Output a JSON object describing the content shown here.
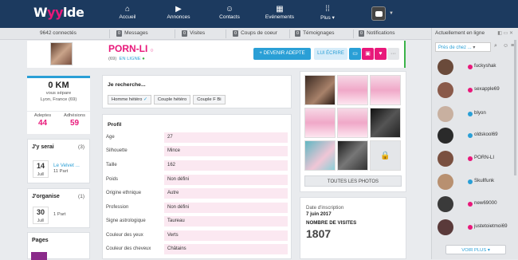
{
  "brand": {
    "logo_prefix": "W",
    "logo_yy": "yy",
    "logo_suffix": "lde"
  },
  "nav": [
    {
      "label": "Accueil",
      "icon": "home-icon"
    },
    {
      "label": "Annonces",
      "icon": "megaphone-icon"
    },
    {
      "label": "Contacts",
      "icon": "users-icon"
    },
    {
      "label": "Evénements",
      "icon": "calendar-icon"
    },
    {
      "label": "Plus",
      "icon": "grid-icon"
    }
  ],
  "stats": {
    "connected": "9642 connectés",
    "messages": {
      "count": "0",
      "label": "Messages"
    },
    "visites": {
      "count": "0",
      "label": "Visites"
    },
    "coups": {
      "count": "0",
      "label": "Coups de coeur"
    },
    "temoignages": {
      "count": "0",
      "label": "Témoignages"
    },
    "notifications": {
      "count": "0",
      "label": "Notifications"
    }
  },
  "profile": {
    "name": "PORN-LI",
    "age": "(69)",
    "status": "EN LIGNE",
    "btn_adepte": "+ DEVENIR ADEPTE",
    "btn_ecrire": "LUI ÉCRIRE"
  },
  "distance": {
    "value": "0 KM",
    "label": "vous sépare",
    "location": "Lyon, France (69)"
  },
  "followers": {
    "adeptes_label": "Adeptes",
    "adeptes": "44",
    "adhesions_label": "Adhésions",
    "adhesions": "59"
  },
  "jyserai": {
    "title": "J'y serai",
    "count": "(3)",
    "event_day": "14",
    "event_month": "Juill",
    "event_title": "Le Velvet ...",
    "event_sub": "11 Part"
  },
  "jorganise": {
    "title": "J'organise",
    "count": "(1)",
    "event_day": "30",
    "event_month": "Juill",
    "event_sub": "1 Part"
  },
  "pages": {
    "title": "Pages"
  },
  "search": {
    "title": "Je recherche...",
    "chips": [
      "Homme hétéro",
      "Couple hétéro",
      "Couple F Bi"
    ]
  },
  "profil": {
    "title": "Profil",
    "rows": [
      {
        "k": "Age",
        "v": "27"
      },
      {
        "k": "Silhouette",
        "v": "Mince"
      },
      {
        "k": "Taille",
        "v": "162"
      },
      {
        "k": "Poids",
        "v": "Non défini"
      },
      {
        "k": "Origine ethnique",
        "v": "Autre"
      },
      {
        "k": "Profession",
        "v": "Non défini"
      },
      {
        "k": "Signe astrologique",
        "v": "Taureau"
      },
      {
        "k": "Couleur des yeux",
        "v": "Verts"
      },
      {
        "k": "Couleur des cheveux",
        "v": "Châtains"
      }
    ]
  },
  "photos": {
    "btn": "TOUTES LES PHOTOS"
  },
  "inscription": {
    "label": "Date d'inscription",
    "date": "7 juin 2017",
    "visits_label": "NOMBRE DE VISITES",
    "visits": "1807"
  },
  "online_panel": {
    "title": "Actuellement en ligne",
    "filter": "Près de chez ...",
    "users": [
      "fuckyshak",
      "sexapple69",
      "blyon",
      "oldskool69",
      "PORN-LI",
      "Skullfunk",
      "new69000",
      "justetoietmoi69"
    ],
    "voir_plus": "VOIR PLUS"
  },
  "colors": {
    "nav": "#1c3a5f",
    "accent": "#2a9fd6",
    "pink": "#e8187a",
    "online": "#3bb34a"
  }
}
